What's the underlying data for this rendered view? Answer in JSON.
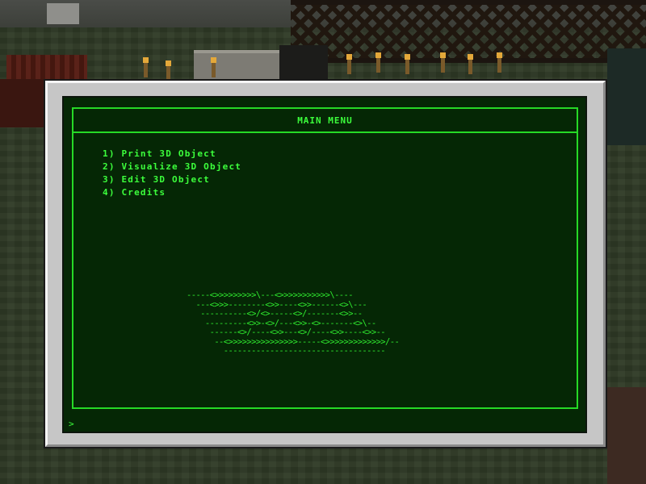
{
  "terminal": {
    "header": {
      "title": "MAIN MENU"
    },
    "menu": [
      {
        "label": "1) Print 3D Object"
      },
      {
        "label": "2) Visualize 3D Object"
      },
      {
        "label": "3) Edit 3D Object"
      },
      {
        "label": "4) Credits"
      }
    ],
    "ascii_art": "-----<>>>>>>>>>\\---<>>>>>>>>>>>\\----\n  ---<>>>--------<>>----<>>------<>\\---\n   ----------<>/<>-----<>/-------<>>--\n    ---------<>>-<>/---<>>-<>-------<>\\--\n     ------<>/----<>>---<>/----<>>----<>>--\n      --<>>>>>>>>>>>>>>>-----<>>>>>>>>>>>>>/--\n        -----------------------------------",
    "prompt": ">"
  },
  "colors": {
    "terminal_bg": "#052705",
    "terminal_text": "#33ff33",
    "frame": "#c6c6c6"
  }
}
